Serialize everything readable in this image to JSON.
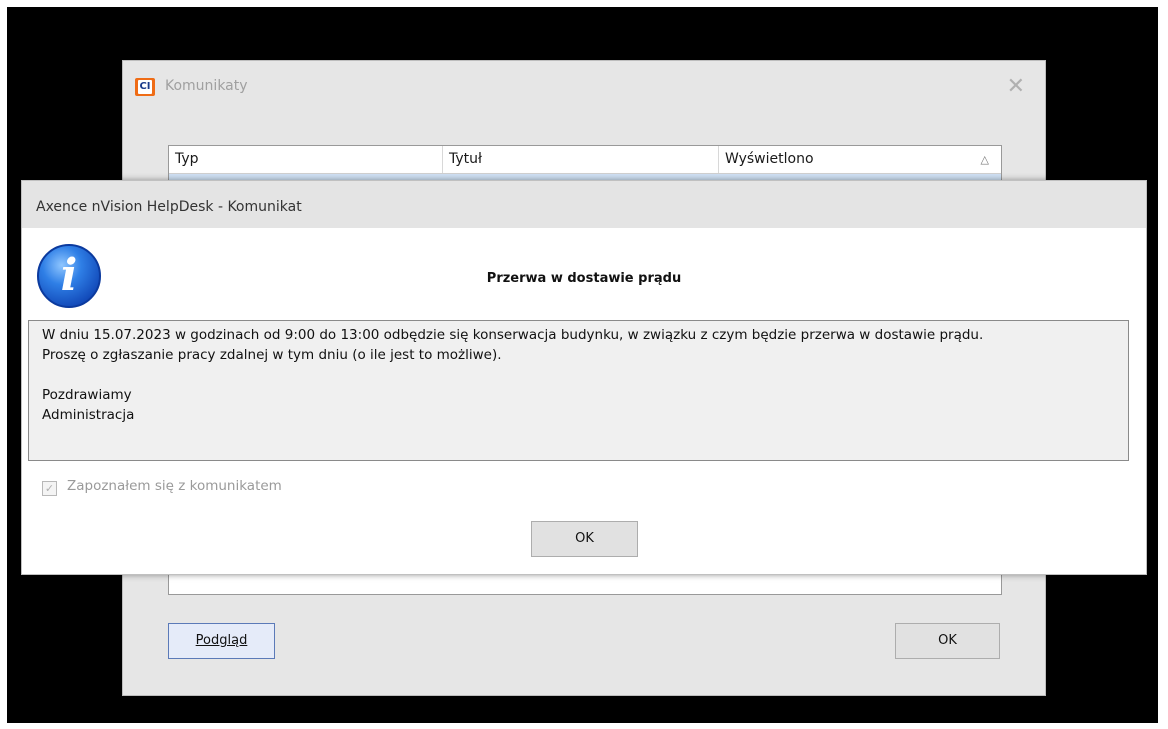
{
  "background_window": {
    "title": "Komunikaty",
    "close_glyph": "✕",
    "app_icon_text": "CI",
    "table": {
      "columns": [
        "Typ",
        "Tytuł",
        "Wyświetlono"
      ],
      "sort_glyph": "△"
    },
    "preview_button": "Podgląd",
    "ok_button": "OK"
  },
  "dialog": {
    "title": "Axence nVision HelpDesk - Komunikat",
    "icon": "info-icon",
    "icon_glyph": "i",
    "message_title": "Przerwa w dostawie prądu",
    "message_lines": [
      "W dniu 15.07.2023 w godzinach od 9:00 do 13:00 odbędzie się konserwacja budynku, w związku z czym będzie przerwa w dostawie prądu.",
      "Proszę o zgłaszanie pracy zdalnej w tym dniu (o ile jest to możliwe).",
      "",
      "Pozdrawiamy",
      "Administracja"
    ],
    "acknowledge_label": "Zapoznałem się z komunikatem",
    "acknowledge_checked": true,
    "ok_button": "OK"
  }
}
